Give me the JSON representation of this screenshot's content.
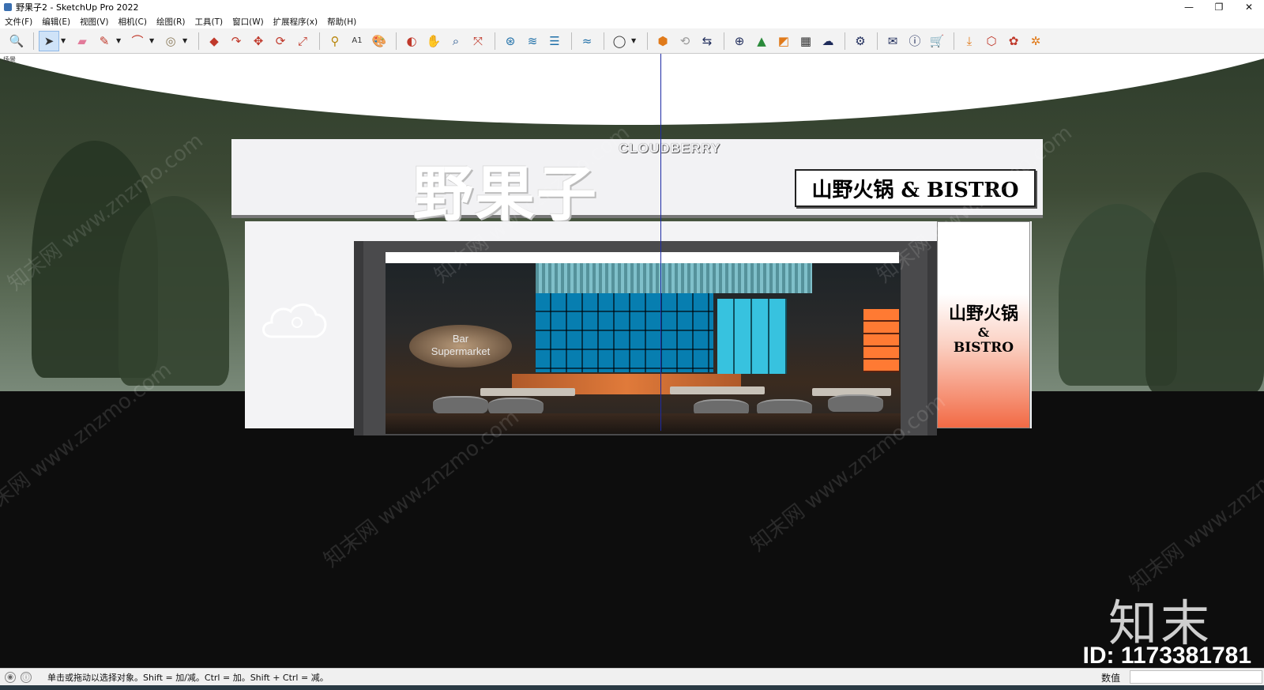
{
  "window": {
    "title": "野果子2 - SketchUp Pro 2022",
    "controls": {
      "minimize": "—",
      "restore": "❐",
      "close": "✕"
    }
  },
  "menu": {
    "items": [
      "文件(F)",
      "编辑(E)",
      "视图(V)",
      "相机(C)",
      "绘图(R)",
      "工具(T)",
      "窗口(W)",
      "扩展程序(x)",
      "帮助(H)"
    ]
  },
  "toolbar": {
    "icons": [
      "zoom-icon",
      "select-icon",
      "eraser-icon",
      "pencil-icon",
      "arc-icon",
      "paint-bucket-icon",
      "push-pull-icon",
      "follow-me-icon",
      "move-icon",
      "rotate-icon",
      "scale-icon",
      "tape-measure-icon",
      "text-icon",
      "paint-icon",
      "orbit-icon",
      "pan-icon",
      "zoom-window-icon",
      "zoom-extents-icon",
      "section-icon",
      "sandbox-icon",
      "layers-icon",
      "outliner-icon",
      "user-icon",
      "3d-warehouse-icon",
      "refresh-icon",
      "export-icon",
      "add-icon",
      "tree-icon",
      "stack-icon",
      "checker-icon",
      "cloud-icon",
      "gears-icon",
      "mail-icon",
      "info-icon",
      "cart-icon",
      "download-icon",
      "plugin-icon",
      "extension-icon",
      "settings-icon"
    ]
  },
  "scene": {
    "tab_label": "场景",
    "sign_logo": "野果子",
    "sign_english": "CLOUDBERRY",
    "bistro_sign": "山野火锅 & BISTRO",
    "side_sign": {
      "line1": "山野火锅",
      "line2": "&",
      "line3": "BISTRO"
    },
    "interior_sign": "Bar\nSupermarket"
  },
  "watermark": {
    "text": "知末网 www.znzmo.com",
    "brand": "知末",
    "id": "ID: 1173381781"
  },
  "status": {
    "hint": "单击或拖动以选择对象。Shift = 加/减。Ctrl = 加。Shift + Ctrl = 减。",
    "measure_label": "数值",
    "measure_value": ""
  },
  "colors": {
    "axis_blue": "#1e2ba5",
    "side_sign_gradient_end": "#f26a45",
    "shelf_cyan": "#2ab3d4"
  }
}
